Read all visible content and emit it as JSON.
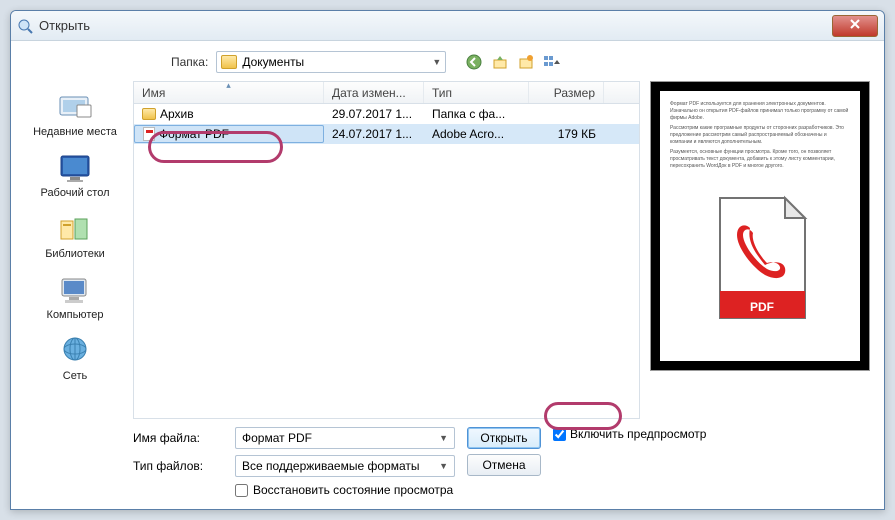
{
  "window": {
    "title": "Открыть"
  },
  "folder": {
    "label": "Папка:",
    "current": "Документы"
  },
  "toolbar_icons": [
    "back-icon",
    "up-icon",
    "new-folder-icon",
    "view-icon"
  ],
  "columns": {
    "name": "Имя",
    "date": "Дата измен...",
    "type": "Тип",
    "size": "Размер"
  },
  "rows": [
    {
      "icon": "folder",
      "name": "Архив",
      "date": "29.07.2017 1...",
      "type": "Папка с фа...",
      "size": ""
    },
    {
      "icon": "pdf",
      "name": "Формат PDF",
      "date": "24.07.2017 1...",
      "type": "Adobe Acro...",
      "size": "179 КБ",
      "selected": true
    }
  ],
  "places": [
    {
      "key": "recent",
      "label": "Недавние места"
    },
    {
      "key": "desktop",
      "label": "Рабочий стол"
    },
    {
      "key": "libraries",
      "label": "Библиотеки"
    },
    {
      "key": "computer",
      "label": "Компьютер"
    },
    {
      "key": "network",
      "label": "Сеть"
    }
  ],
  "filename": {
    "label": "Имя файла:",
    "value": "Формат PDF"
  },
  "filetype": {
    "label": "Тип файлов:",
    "value": "Все поддерживаемые форматы"
  },
  "restore": {
    "label": "Восстановить состояние просмотра",
    "checked": false
  },
  "buttons": {
    "open": "Открыть",
    "cancel": "Отмена"
  },
  "preview_check": {
    "label": "Включить предпросмотр",
    "checked": true
  },
  "pdf_badge": "PDF"
}
